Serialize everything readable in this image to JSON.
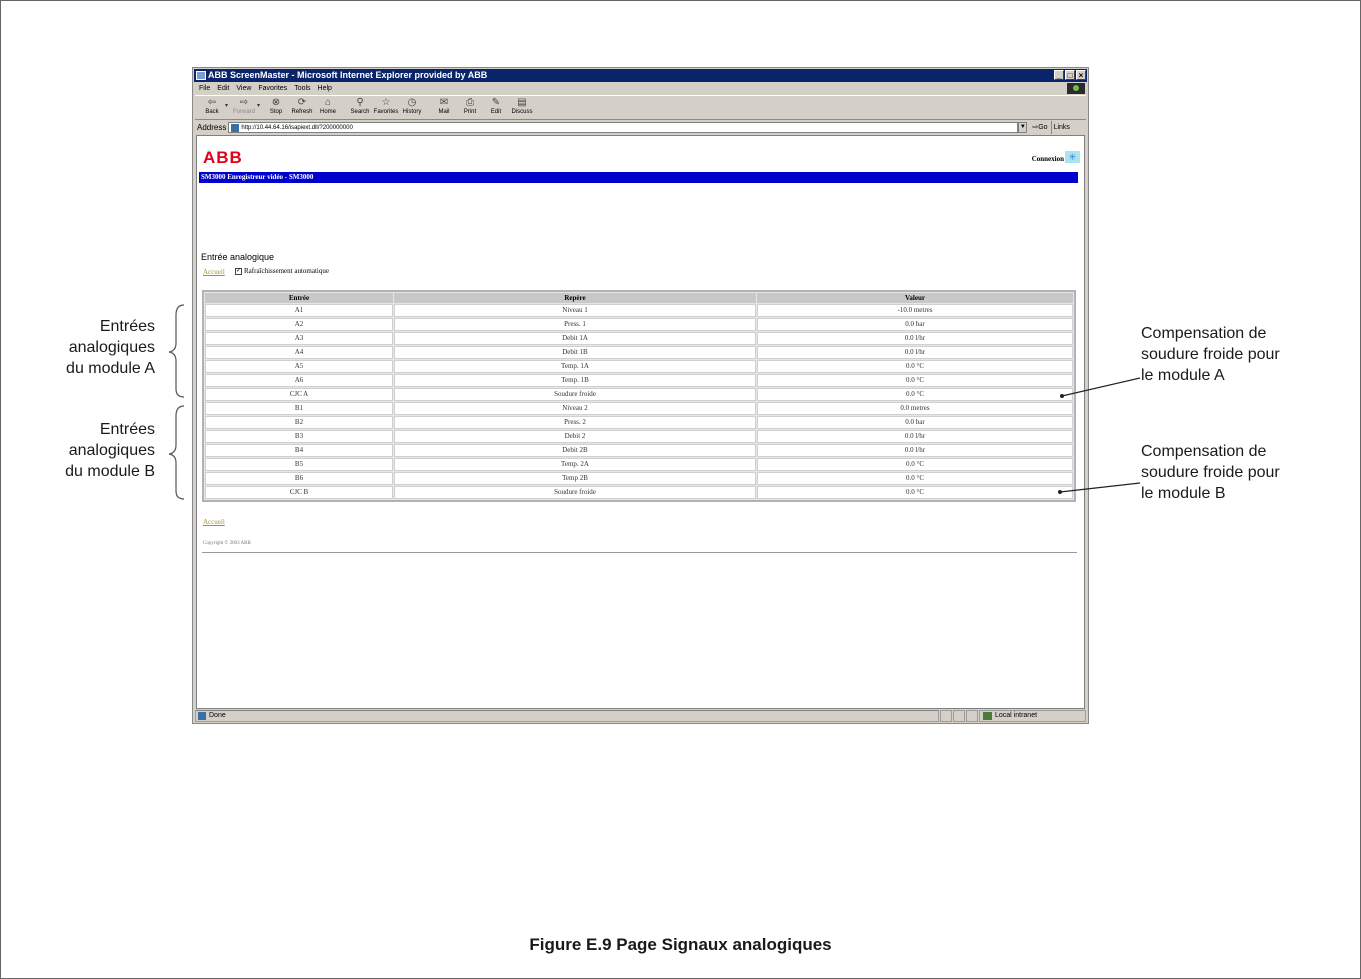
{
  "browser": {
    "title": "ABB ScreenMaster - Microsoft Internet Explorer provided by ABB",
    "window_buttons": [
      "_",
      "□",
      "×"
    ],
    "menu": [
      "File",
      "Edit",
      "View",
      "Favorites",
      "Tools",
      "Help"
    ],
    "toolbar": [
      {
        "label": "Back",
        "icon": "back-arrow-icon",
        "glyph": "⇦"
      },
      {
        "label": "Forward",
        "icon": "forward-arrow-icon",
        "glyph": "⇨"
      },
      {
        "label": "Stop",
        "icon": "stop-icon",
        "glyph": "⊗"
      },
      {
        "label": "Refresh",
        "icon": "refresh-icon",
        "glyph": "⟳"
      },
      {
        "label": "Home",
        "icon": "home-icon",
        "glyph": "⌂"
      },
      {
        "label": "Search",
        "icon": "search-icon",
        "glyph": "⚲"
      },
      {
        "label": "Favorites",
        "icon": "favorites-icon",
        "glyph": "☆"
      },
      {
        "label": "History",
        "icon": "history-icon",
        "glyph": "◷"
      },
      {
        "label": "Mail",
        "icon": "mail-icon",
        "glyph": "✉"
      },
      {
        "label": "Print",
        "icon": "print-icon",
        "glyph": "⎙"
      },
      {
        "label": "Edit",
        "icon": "edit-icon",
        "glyph": "✎"
      },
      {
        "label": "Discuss",
        "icon": "discuss-icon",
        "glyph": "▤"
      }
    ],
    "address_label": "Address",
    "address_url": "http://10.44.64.16/isapiext.dll/?200000000",
    "go_label": "Go",
    "links_label": "Links",
    "status_text": "Done",
    "zone_text": "Local intranet"
  },
  "page": {
    "logo": "ABB",
    "connexion_label": "Connexion",
    "title_bar": "SM3000 Enregistreur vidéo - SM3000",
    "section_heading": "Entrée analogique",
    "accueil_link": "Accueil",
    "auto_refresh_label": "Rafraîchissement automatique",
    "auto_refresh_checked": true,
    "table": {
      "headers": [
        "Entrée",
        "Repère",
        "Valeur"
      ],
      "rows": [
        [
          "A1",
          "Niveau 1",
          "-10.0 metres"
        ],
        [
          "A2",
          "Press. 1",
          "0.0 bar"
        ],
        [
          "A3",
          "Debit 1A",
          "0.0 l/hr"
        ],
        [
          "A4",
          "Debit 1B",
          "0.0 l/hr"
        ],
        [
          "A5",
          "Temp. 1A",
          "0.0 °C"
        ],
        [
          "A6",
          "Temp. 1B",
          "0.0 °C"
        ],
        [
          "CJC A",
          "Soudure froide",
          "0.0 °C"
        ],
        [
          "B1",
          "Niveau 2",
          "0.0 metres"
        ],
        [
          "B2",
          "Press. 2",
          "0.0 bar"
        ],
        [
          "B3",
          "Debit 2",
          "0.0 l/hr"
        ],
        [
          "B4",
          "Debit 2B",
          "0.0 l/hr"
        ],
        [
          "B5",
          "Temp. 2A",
          "0.0 °C"
        ],
        [
          "B6",
          "Temp 2B",
          "0.0 °C"
        ],
        [
          "CJC B",
          "Soudure froide",
          "0.0 °C"
        ]
      ]
    },
    "accueil_bottom": "Accueil",
    "copyright": "Copyright © 2003 ABB"
  },
  "annotations": {
    "left_a": [
      "Entrées",
      "analogiques",
      "du module A"
    ],
    "left_b": [
      "Entrées",
      "analogiques",
      "du module B"
    ],
    "right_a": [
      "Compensation de",
      "soudure froide pour",
      "le module A"
    ],
    "right_b": [
      "Compensation de",
      "soudure froide pour",
      "le module B"
    ]
  },
  "caption": "Figure E.9 Page Signaux analogiques"
}
